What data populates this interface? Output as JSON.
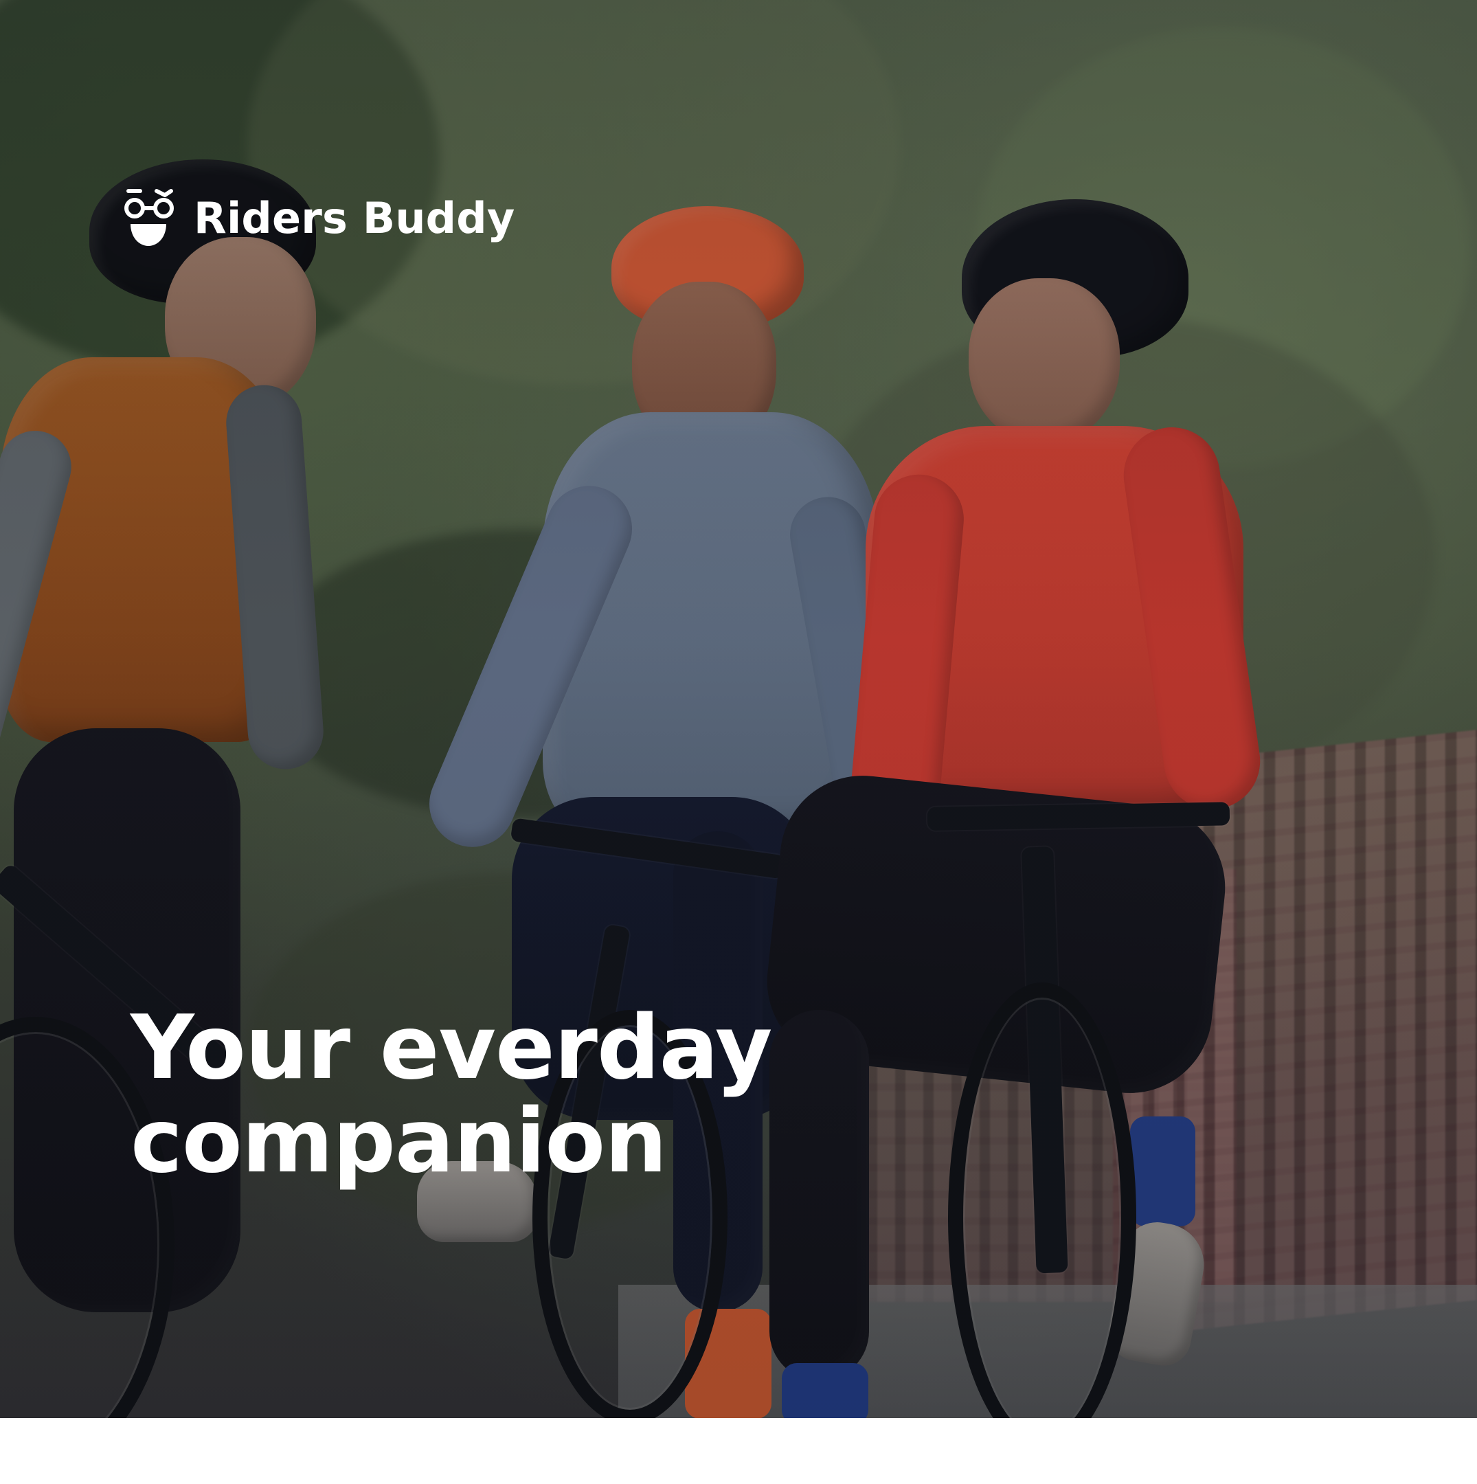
{
  "brand": {
    "name": "Riders Buddy",
    "icon": "riders-buddy-face-icon",
    "color": "#ffffff"
  },
  "hero": {
    "headline_lines": [
      "Your everday",
      "companion"
    ],
    "image": "three-cyclists-talking-outdoors",
    "colors": {
      "text": "#ffffff",
      "page_background": "#ffffff",
      "overlay": "#0e1218"
    }
  }
}
